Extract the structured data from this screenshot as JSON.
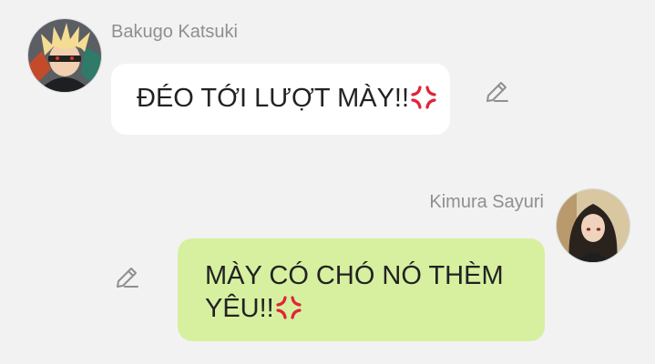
{
  "messages": [
    {
      "sender": "Bakugo Katsuki",
      "text": "ĐÉO TỚI LƯỢT MÀY!!",
      "emoji": "anger-symbol-icon",
      "side": "left"
    },
    {
      "sender": "Kimura Sayuri",
      "text": "MÀY CÓ CHÓ NÓ THÈM YÊU!!",
      "emoji": "anger-symbol-icon",
      "side": "right"
    }
  ],
  "icons": {
    "edit": "pencil-icon",
    "avatar": "avatar"
  },
  "colors": {
    "background": "#f2f2f2",
    "incoming_bubble": "#ffffff",
    "outgoing_bubble": "#d6f0a0",
    "sender_name": "#8f8f8f",
    "anger_symbol": "#e0243a"
  }
}
